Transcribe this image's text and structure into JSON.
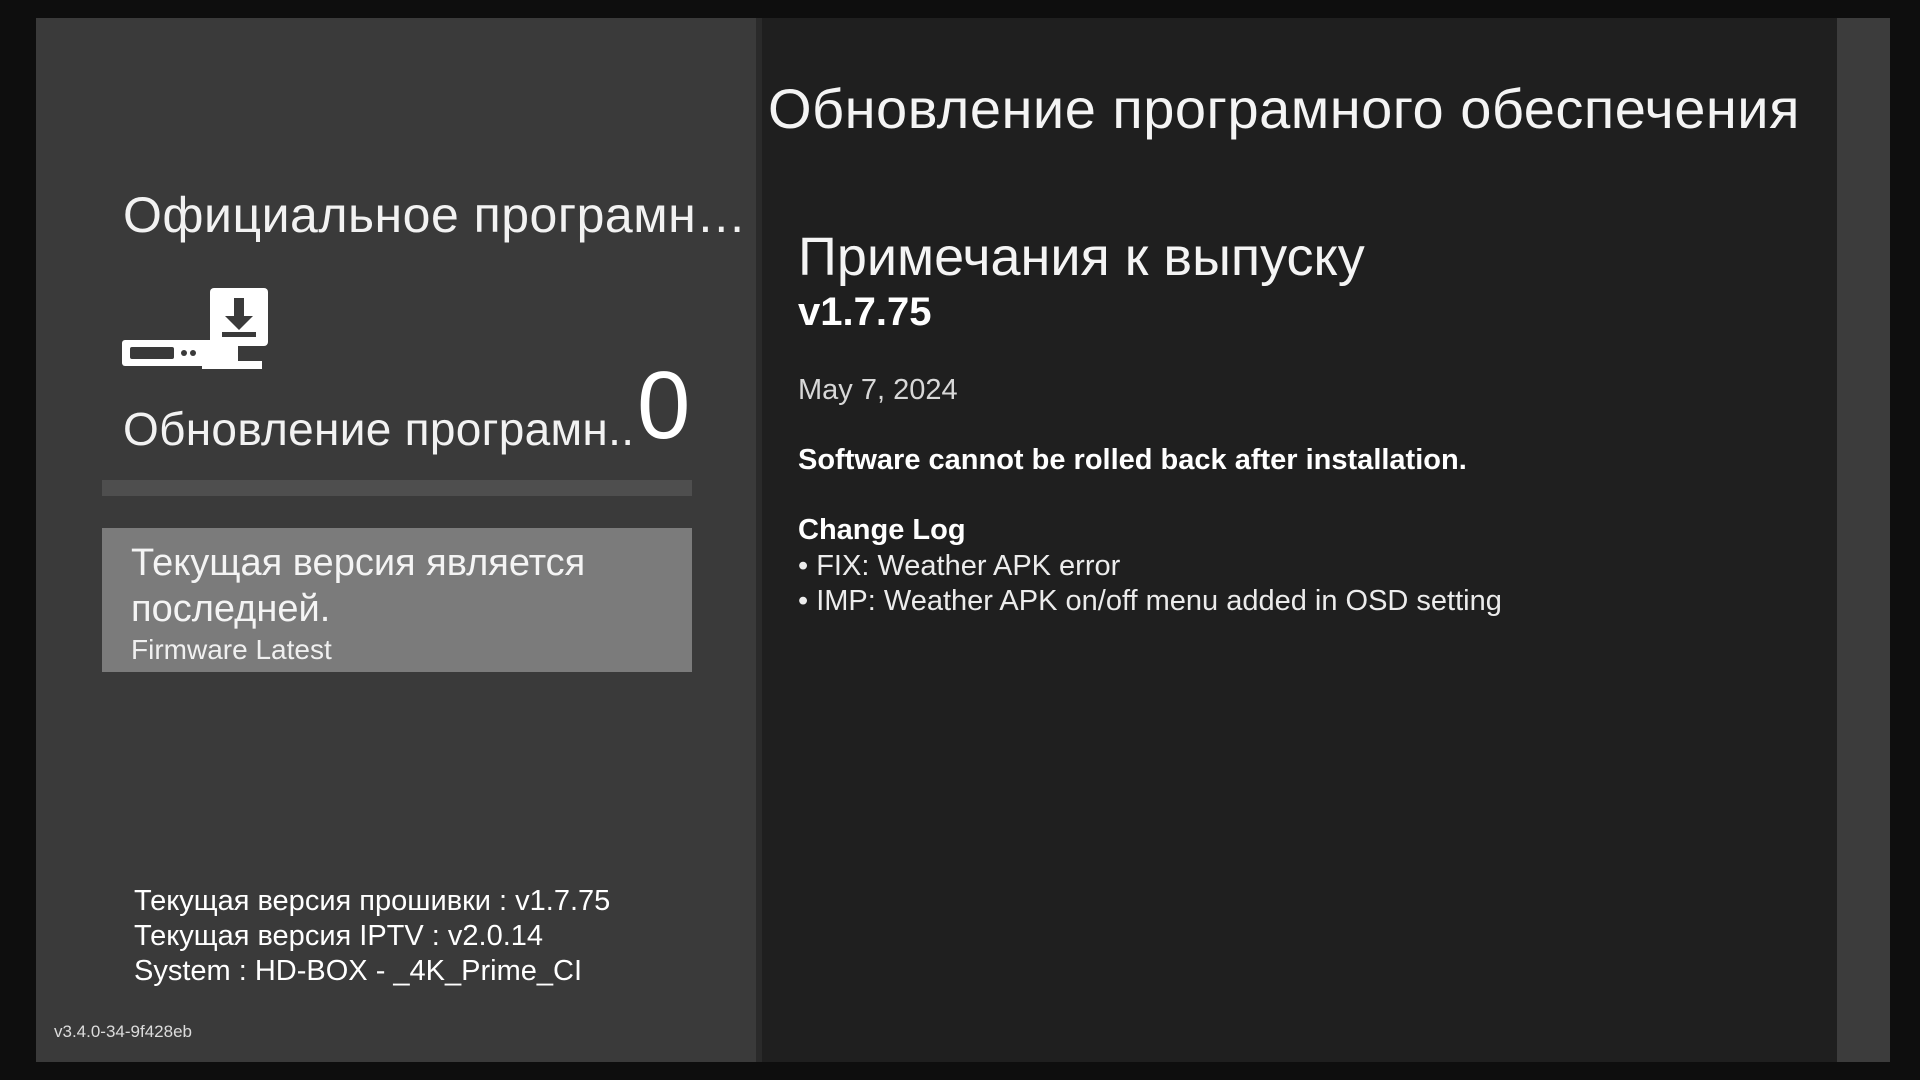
{
  "left": {
    "source_title": "Официальное програмно...",
    "update_label": "Обновление програмн..",
    "update_count": "0",
    "progress_percent": 0,
    "status_title": "Текущая версия является последней.",
    "status_subtitle": "Firmware Latest",
    "sysinfo": {
      "firmware": "Текущая версия прошивки : v1.7.75",
      "iptv": "Текущая версия IPTV : v2.0.14",
      "system": "System : HD-BOX - _4K_Prime_CI"
    },
    "build_tag": "v3.4.0-34-9f428eb"
  },
  "right": {
    "page_title": "Обновление програмного обеспечения",
    "notes_title": "Примечания к выпуску",
    "notes_version": "v1.7.75",
    "notes_date": "May 7, 2024",
    "warning": "Software cannot be rolled back after installation.",
    "changelog_title": "Change Log",
    "changelog_items": [
      "• FIX: Weather APK error",
      "• IMP: Weather APK on/off menu added in OSD setting"
    ]
  },
  "icons": {
    "device": "set-top-box-download-icon"
  },
  "colors": {
    "left_panel": "#3a3a3a",
    "right_panel": "#1f1f1f",
    "status_box": "#7b7b7b",
    "progress_track": "#4e4e4e"
  }
}
